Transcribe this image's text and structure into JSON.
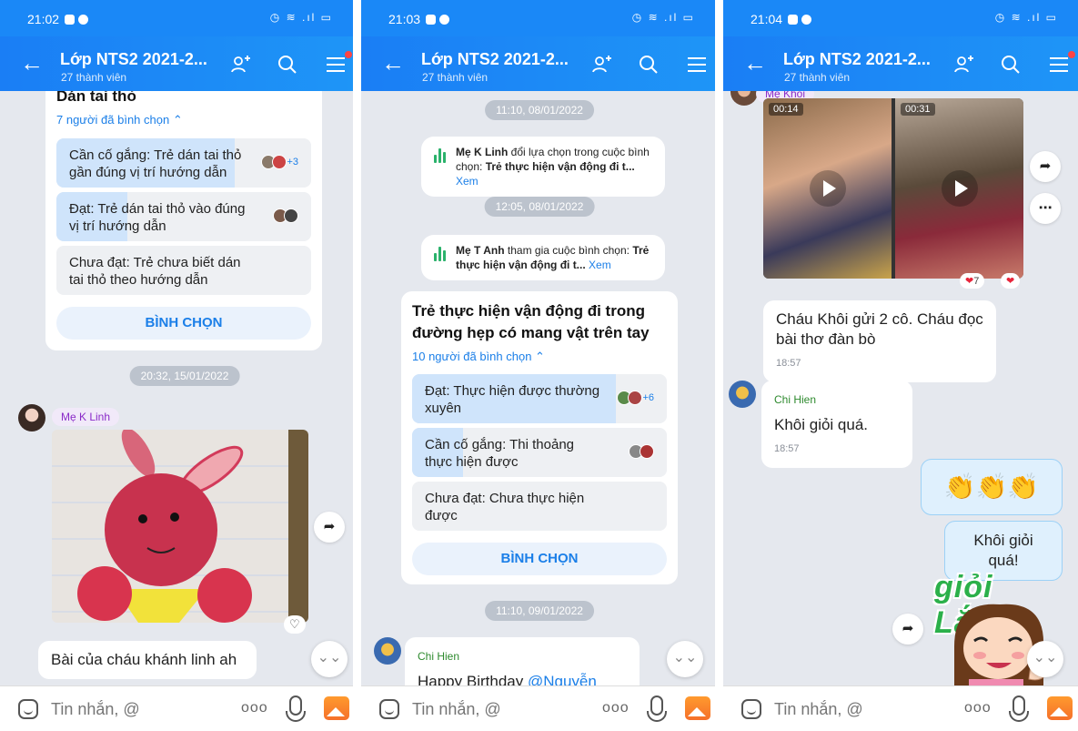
{
  "app": {
    "colors": {
      "header": "#1a88f7",
      "accent": "#1b7fe8",
      "vote_fill": "#cfe4fb"
    }
  },
  "chat": {
    "title": "Lớp NTS2 2021-2...",
    "members": "27 thành viên"
  },
  "composer": {
    "placeholder": "Tin nhắn, @",
    "more_label": "ooo"
  },
  "panel1": {
    "time": "21:02",
    "poll": {
      "question": "Dán tai thỏ",
      "votes": "7 người đã bình chọn ⌃",
      "options": [
        {
          "text": "Cần cố gắng: Trẻ dán tai thỏ gần đúng vị trí hướng dẫn",
          "extra": "+3",
          "fill": 0.7
        },
        {
          "text": "Đạt: Trẻ dán tai thỏ vào đúng vị trí hướng dẫn",
          "extra": "",
          "fill": 0.28
        },
        {
          "text": "Chưa đạt: Trẻ chưa biết dán tai thỏ theo hướng dẫn",
          "extra": "",
          "fill": 0
        }
      ],
      "vote_button": "BÌNH CHỌN"
    },
    "time_pill": "20:32, 15/01/2022",
    "sender": "Mẹ K Linh",
    "message": "Bài của cháu khánh linh ah"
  },
  "panel2": {
    "time": "21:03",
    "time_pill_1": "11:10, 08/01/2022",
    "sys1": {
      "actor": "Mẹ K Linh",
      "action": " đổi lựa chọn trong cuộc bình chọn: ",
      "target": "Trẻ thực hiện vận động đi t...",
      "link": " Xem"
    },
    "time_pill_2": "12:05, 08/01/2022",
    "sys2": {
      "actor": "Mẹ T Anh",
      "action": " tham gia cuộc bình chọn: ",
      "target": "Trẻ thực hiện vận động đi t...",
      "link": " Xem"
    },
    "poll": {
      "question": "Trẻ thực hiện vận động đi trong đường hẹp có mang vật trên tay",
      "votes": "10 người đã bình chọn ⌃",
      "options": [
        {
          "text": "Đạt: Thực hiện được thường xuyên",
          "extra": "+6",
          "fill": 0.8
        },
        {
          "text": "Cần cố gắng: Thi thoảng thực hiện được",
          "extra": "",
          "fill": 0.2
        },
        {
          "text": "Chưa đạt: Chưa thực hiện được",
          "extra": "",
          "fill": 0
        }
      ],
      "vote_button": "BÌNH CHỌN"
    },
    "time_pill_3": "11:10, 09/01/2022",
    "sender": "Chi Hien",
    "message": "Happy Birthday ",
    "mention": "@Nguyễn Thơi"
  },
  "panel3": {
    "time": "21:04",
    "sender_top": "Mẹ Khôi",
    "videos": [
      {
        "duration": "00:14"
      },
      {
        "duration": "00:31"
      }
    ],
    "reaction_count": "7",
    "msg1": {
      "text": "Cháu Khôi gửi 2 cô. Cháu đọc bài thơ đàn bò",
      "time": "18:57"
    },
    "msg2": {
      "sender": "Chi Hien",
      "text": "Khôi giỏi quá.",
      "time": "18:57"
    },
    "emoji_msg": "👏👏👏",
    "mine_msg": "Khôi giỏi quá!",
    "sticker": "giỏi Lắm!"
  }
}
